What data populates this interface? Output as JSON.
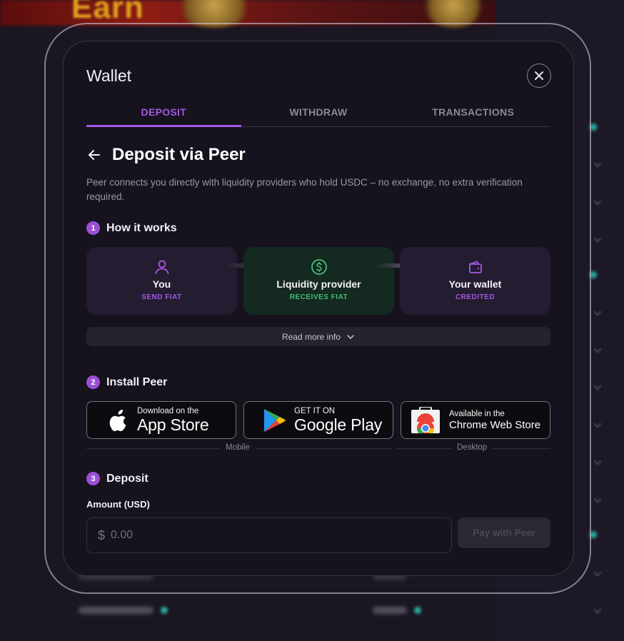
{
  "background": {
    "banner_text": "Earn"
  },
  "wallet": {
    "title": "Wallet",
    "tabs": [
      {
        "label": "DEPOSIT",
        "active": true
      },
      {
        "label": "WITHDRAW",
        "active": false
      },
      {
        "label": "TRANSACTIONS",
        "active": false
      }
    ],
    "heading": "Deposit via Peer",
    "description": "Peer connects you directly with liquidity providers who hold USDC – no exchange, no extra verification required.",
    "steps": [
      {
        "number": "1",
        "label": "How it works"
      },
      {
        "number": "2",
        "label": "Install Peer"
      },
      {
        "number": "3",
        "label": "Deposit"
      }
    ],
    "flow": [
      {
        "title": "You",
        "subtitle": "SEND FIAT",
        "icon": "user-icon"
      },
      {
        "title": "Liquidity provider",
        "subtitle": "RECEIVES FIAT",
        "icon": "dollar-circle-icon"
      },
      {
        "title": "Your wallet",
        "subtitle": "CREDITED",
        "icon": "wallet-icon"
      }
    ],
    "read_more": "Read more info",
    "stores": {
      "app_store": {
        "small": "Download on the",
        "big": "App Store"
      },
      "google_play": {
        "small": "GET IT ON",
        "big": "Google Play"
      },
      "chrome": {
        "small": "Available in the",
        "big": "Chrome Web Store"
      },
      "mobile_label": "Mobile",
      "desktop_label": "Desktop"
    },
    "amount": {
      "label": "Amount (USD)",
      "currency_symbol": "$",
      "placeholder": "0.00"
    },
    "pay_button": "Pay with Peer"
  },
  "colors": {
    "accent": "#a457e6",
    "green": "#3fc07a",
    "modal_bg": "#16131e"
  }
}
